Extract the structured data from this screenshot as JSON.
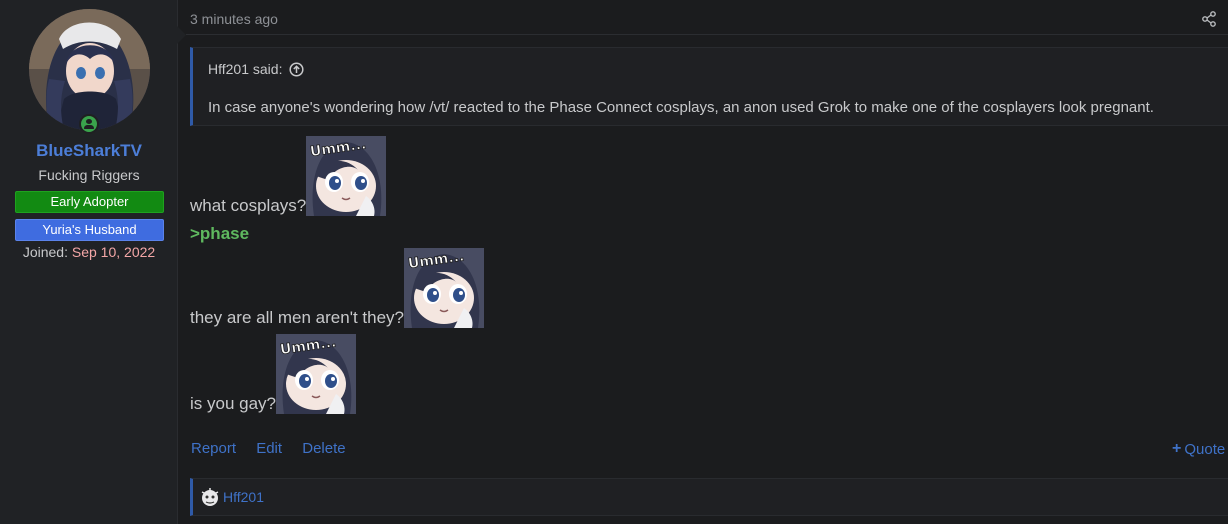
{
  "user": {
    "name": "BlueSharkTV",
    "title": "Fucking Riggers",
    "banners": [
      "Early Adopter",
      "Yuria's Husband"
    ],
    "joined_label": "Joined:",
    "joined_date": "Sep 10, 2022",
    "online": true
  },
  "post": {
    "timestamp": "3 minutes ago",
    "quote": {
      "author_said": "Hff201 said:",
      "text": "In case anyone's wondering how /vt/ reacted to the Phase Connect cosplays, an anon used Grok to make one of the cosplayers look pregnant."
    },
    "lines": [
      "what cosplays?",
      ">phase",
      "they are all men aren't they?",
      "is you gay?"
    ],
    "emote_caption": "Umm..."
  },
  "actions": {
    "report": "Report",
    "edit": "Edit",
    "delete": "Delete",
    "quote": "Quote"
  },
  "reactions": {
    "reactor": "Hff201"
  },
  "colors": {
    "link": "#3f72c8",
    "username": "#4c7ed8",
    "greentext": "#5fb85f",
    "early_adopter": "#128a12",
    "husband_banner": "#3f6ce0"
  }
}
